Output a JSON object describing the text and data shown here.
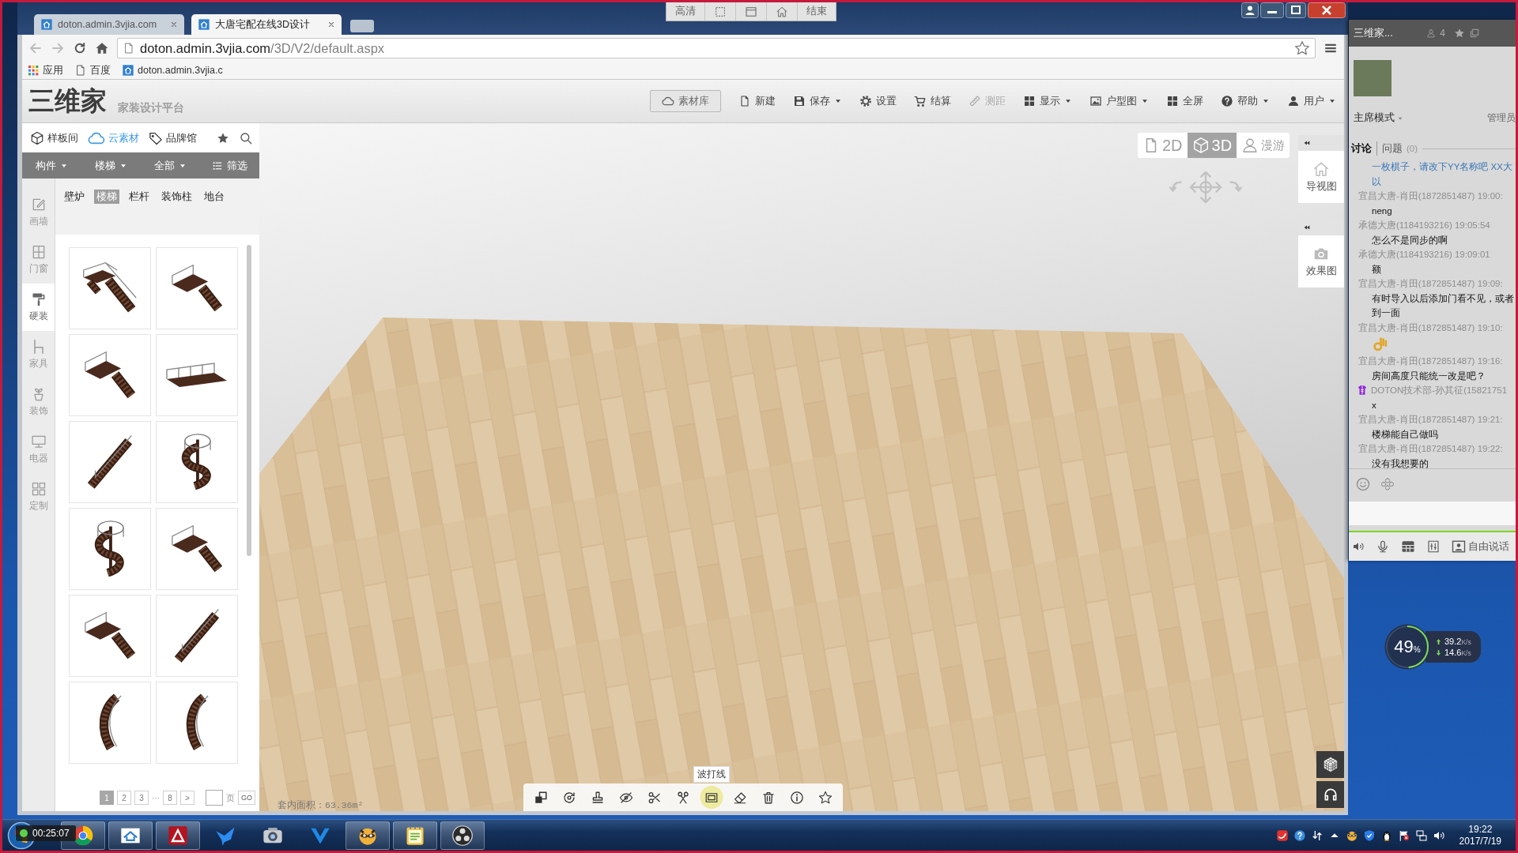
{
  "recording_bar": {
    "items": [
      {
        "kind": "text",
        "label": "高清"
      },
      {
        "kind": "region"
      },
      {
        "kind": "window"
      },
      {
        "kind": "home"
      },
      {
        "kind": "text",
        "label": "结束"
      }
    ]
  },
  "browser": {
    "tabs": [
      {
        "title": "doton.admin.3vjia.com",
        "selected": false
      },
      {
        "title": "大唐宅配在线3D设计",
        "selected": true
      }
    ],
    "can_go_back": false,
    "can_go_forward": false,
    "address": {
      "host": "doton.admin.3vjia.com",
      "path": "/3D/V2/default.aspx"
    },
    "bookmarks": [
      {
        "kind": "apps",
        "label": "应用"
      },
      {
        "kind": "page",
        "label": "百度"
      },
      {
        "kind": "site",
        "label": "doton.admin.3vjia.c"
      }
    ]
  },
  "app": {
    "logo": "三维家",
    "tagline": "家装设计平台",
    "toolbar": [
      {
        "kind": "library",
        "label": "素材库",
        "dropdown": false,
        "disabled": false
      },
      {
        "kind": "new",
        "label": "新建",
        "dropdown": false,
        "disabled": false
      },
      {
        "kind": "save",
        "label": "保存",
        "dropdown": true,
        "disabled": false
      },
      {
        "kind": "settings",
        "label": "设置",
        "dropdown": false,
        "disabled": false
      },
      {
        "kind": "checkout",
        "label": "结算",
        "dropdown": false,
        "disabled": false
      },
      {
        "kind": "measure",
        "label": "测距",
        "dropdown": false,
        "disabled": true
      },
      {
        "kind": "display",
        "label": "显示",
        "dropdown": true,
        "disabled": false
      },
      {
        "kind": "floorplan",
        "label": "户型图",
        "dropdown": true,
        "disabled": false
      },
      {
        "kind": "fullscreen",
        "label": "全屏",
        "dropdown": false,
        "disabled": false
      },
      {
        "kind": "help",
        "label": "帮助",
        "dropdown": true,
        "disabled": false
      },
      {
        "kind": "user",
        "label": "用户",
        "dropdown": true,
        "disabled": false
      }
    ],
    "library_tabs": [
      {
        "kind": "room",
        "label": "样板间",
        "selected": false
      },
      {
        "kind": "cloud",
        "label": "云素材",
        "selected": true
      },
      {
        "kind": "brand",
        "label": "品牌馆",
        "selected": false
      }
    ],
    "filters": [
      {
        "kind": "dropdown",
        "label": "构件"
      },
      {
        "kind": "dropdown",
        "label": "楼梯"
      },
      {
        "kind": "dropdown",
        "label": "全部"
      },
      {
        "kind": "list",
        "label": "筛选"
      }
    ],
    "categories": [
      {
        "kind": "wall",
        "label": "画墙",
        "selected": false
      },
      {
        "kind": "opening",
        "label": "门窗",
        "selected": false
      },
      {
        "kind": "hard",
        "label": "硬装",
        "selected": true
      },
      {
        "kind": "furniture",
        "label": "家具",
        "selected": false
      },
      {
        "kind": "decor",
        "label": "装饰",
        "selected": false
      },
      {
        "kind": "appliance",
        "label": "电器",
        "selected": false
      },
      {
        "kind": "custom",
        "label": "定制",
        "selected": false
      }
    ],
    "subcategories": [
      {
        "label": "壁炉",
        "selected": false
      },
      {
        "label": "楼梯",
        "selected": true
      },
      {
        "label": "栏杆",
        "selected": false
      },
      {
        "label": "装饰柱",
        "selected": false
      },
      {
        "label": "地台",
        "selected": false
      }
    ],
    "models": [
      {
        "kind": "uturn"
      },
      {
        "kind": "lturn"
      },
      {
        "kind": "lturn"
      },
      {
        "kind": "landing"
      },
      {
        "kind": "straight"
      },
      {
        "kind": "spiral"
      },
      {
        "kind": "spiral"
      },
      {
        "kind": "lturn"
      },
      {
        "kind": "lturn"
      },
      {
        "kind": "straight"
      },
      {
        "kind": "curved"
      },
      {
        "kind": "curved"
      }
    ],
    "pagination": {
      "pages": [
        {
          "label": "1",
          "selected": true
        },
        {
          "label": "2",
          "selected": false
        },
        {
          "label": "3",
          "selected": false
        }
      ],
      "ellipsis": "···",
      "last": "8",
      "next": ">",
      "unit": "页",
      "go": "GO"
    },
    "viewport": {
      "view_modes": [
        {
          "kind": "plan",
          "label": "2D",
          "selected": false
        },
        {
          "kind": "perspective",
          "label": "3D",
          "selected": true
        },
        {
          "kind": "walk",
          "label": "漫游",
          "selected": false
        }
      ],
      "side_panels": [
        {
          "kind": "guide",
          "label": "导视图"
        },
        {
          "kind": "render",
          "label": "效果图"
        }
      ],
      "area": "套内面积：63.36m²",
      "tools": [
        {
          "kind": "swap",
          "highlighted": false
        },
        {
          "kind": "rotate",
          "highlighted": false
        },
        {
          "kind": "stamp",
          "highlighted": false
        },
        {
          "kind": "hide",
          "highlighted": false
        },
        {
          "kind": "cut",
          "highlighted": false
        },
        {
          "kind": "split",
          "highlighted": false
        },
        {
          "kind": "border",
          "highlighted": true,
          "tooltip": "波打线"
        },
        {
          "kind": "erase",
          "highlighted": false
        },
        {
          "kind": "delete",
          "highlighted": false
        },
        {
          "kind": "info",
          "highlighted": false
        },
        {
          "kind": "favorite",
          "highlighted": false
        }
      ]
    }
  },
  "chat": {
    "title": "三维家...",
    "member_count": "4",
    "mode": "主席模式",
    "role": "管理员",
    "tabs": [
      {
        "label": "讨论",
        "selected": true
      },
      {
        "label": "问题",
        "count": "(0)",
        "selected": false
      }
    ],
    "messages": [
      {
        "kind": "notice",
        "lines": [
          "一枚棋子，请改下YY名称吧 XX大",
          "以"
        ]
      },
      {
        "kind": "text",
        "sender": "宜昌大唐-肖田(1872851487) 19:00:",
        "admin": false,
        "lines": [
          "neng"
        ]
      },
      {
        "kind": "text",
        "sender": "承德大唐(1184193216) 19:05:54",
        "admin": false,
        "lines": [
          "怎么不是同步的啊"
        ]
      },
      {
        "kind": "text",
        "sender": "承德大唐(1184193216) 19:09:01",
        "admin": false,
        "lines": [
          "额"
        ]
      },
      {
        "kind": "text",
        "sender": "宜昌大唐-肖田(1872851487) 19:09:",
        "admin": false,
        "lines": [
          "有时导入以后添加门看不见，或者",
          "到一面"
        ]
      },
      {
        "kind": "emoji",
        "sender": "宜昌大唐-肖田(1872851487) 19:10:",
        "admin": false
      },
      {
        "kind": "text",
        "sender": "宜昌大唐-肖田(1872851487) 19:16:",
        "admin": false,
        "lines": [
          "房间高度只能统一改是吧？"
        ]
      },
      {
        "kind": "text",
        "sender": "DOTON技术部-孙其征(15821751",
        "admin": true,
        "lines": [
          "x"
        ]
      },
      {
        "kind": "text",
        "sender": "宜昌大唐-肖田(1872851487) 19:21:",
        "admin": false,
        "lines": [
          "楼梯能自己做吗"
        ]
      },
      {
        "kind": "text",
        "sender": "宜昌大唐-肖田(1872851487) 19:22:",
        "admin": false,
        "lines": [
          "没有我想要的"
        ]
      }
    ],
    "voice_mode": "自由说话"
  },
  "network": {
    "percent": "49",
    "percent_unit": "%",
    "level": 0.49,
    "upload": {
      "value": "39.2",
      "unit": "K/s"
    },
    "download": {
      "value": "14.6",
      "unit": "K/s"
    }
  },
  "taskbar": {
    "timer": "00:25:07",
    "apps": [
      {
        "kind": "ring",
        "running": true
      },
      {
        "kind": "house",
        "running": true
      },
      {
        "kind": "triangle",
        "running": true
      },
      {
        "kind": "bird",
        "running": false
      },
      {
        "kind": "camera",
        "running": false
      },
      {
        "kind": "chevron",
        "running": false
      },
      {
        "kind": "raccoon",
        "running": true
      },
      {
        "kind": "notepad",
        "running": true
      },
      {
        "kind": "obs",
        "running": true
      }
    ],
    "tray": [
      {
        "kind": "swoosh"
      },
      {
        "kind": "help"
      },
      {
        "kind": "transfer"
      },
      {
        "kind": "chevron"
      },
      {
        "kind": "raccoon"
      },
      {
        "kind": "shield"
      },
      {
        "kind": "penguin"
      },
      {
        "kind": "flag"
      },
      {
        "kind": "network"
      },
      {
        "kind": "volume"
      }
    ],
    "time": "19:22",
    "date": "2017/7/19"
  }
}
